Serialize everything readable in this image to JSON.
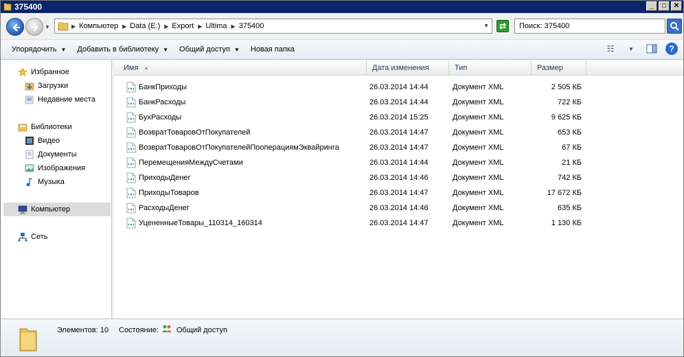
{
  "window": {
    "title": "375400"
  },
  "address": {
    "crumbs": [
      "Компьютер",
      "Data (E:)",
      "Export",
      "Ultima",
      "375400"
    ],
    "search_placeholder": "Поиск: 375400"
  },
  "toolbar": {
    "organize": "Упорядочить",
    "add_to_library": "Добавить в библиотеку",
    "share": "Общий доступ",
    "new_folder": "Новая папка"
  },
  "sidebar": {
    "favorites": "Избранное",
    "downloads": "Загрузки",
    "recent": "Недавние места",
    "libraries": "Библиотеки",
    "video": "Видео",
    "documents": "Документы",
    "images": "Изображения",
    "music": "Музыка",
    "computer": "Компьютер",
    "network": "Сеть"
  },
  "columns": {
    "name": "Имя",
    "date": "Дата изменения",
    "type": "Тип",
    "size": "Размер"
  },
  "files": [
    {
      "name": "БанкПриходы",
      "date": "26.03.2014 14:44",
      "type": "Документ XML",
      "size": "2 505 КБ"
    },
    {
      "name": "БанкРасходы",
      "date": "26.03.2014 14:44",
      "type": "Документ XML",
      "size": "722 КБ"
    },
    {
      "name": "БухРасходы",
      "date": "26.03.2014 15:25",
      "type": "Документ XML",
      "size": "9 625 КБ"
    },
    {
      "name": "ВозвратТоваровОтПокупателей",
      "date": "26.03.2014 14:47",
      "type": "Документ XML",
      "size": "653 КБ"
    },
    {
      "name": "ВозвратТоваровОтПокупателейПооперациямЭквайринга",
      "date": "26.03.2014 14:47",
      "type": "Документ XML",
      "size": "67 КБ"
    },
    {
      "name": "ПеремещенияМеждуСчетами",
      "date": "26.03.2014 14:44",
      "type": "Документ XML",
      "size": "21 КБ"
    },
    {
      "name": "ПриходыДенег",
      "date": "26.03.2014 14:46",
      "type": "Документ XML",
      "size": "742 КБ"
    },
    {
      "name": "ПриходыТоваров",
      "date": "26.03.2014 14:47",
      "type": "Документ XML",
      "size": "17 672 КБ"
    },
    {
      "name": "РасходыДенег",
      "date": "26.03.2014 14:46",
      "type": "Документ XML",
      "size": "635 КБ"
    },
    {
      "name": "УцененныеТовары_110314_160314",
      "date": "26.03.2014 14:47",
      "type": "Документ XML",
      "size": "1 130 КБ"
    }
  ],
  "status": {
    "items_label": "Элементов: 10",
    "state_label": "Состояние:",
    "state_value": "Общий доступ"
  }
}
